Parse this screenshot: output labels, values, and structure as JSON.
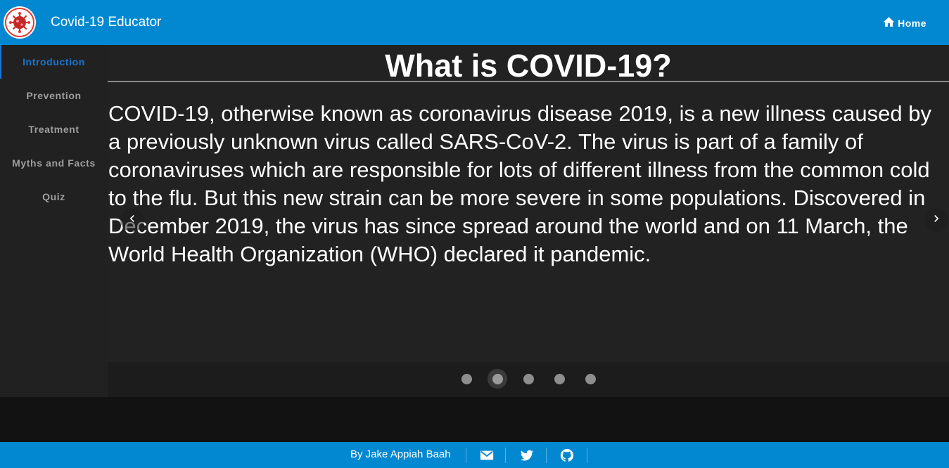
{
  "header": {
    "app_title": "Covid-19 Educator",
    "home_label": "Home",
    "logo_icon": "virus-logo-icon",
    "home_icon": "home-icon"
  },
  "sidebar": {
    "items": [
      {
        "label": "Introduction",
        "active": true
      },
      {
        "label": "Prevention",
        "active": false
      },
      {
        "label": "Treatment",
        "active": false
      },
      {
        "label": "Myths and Facts",
        "active": false
      },
      {
        "label": "Quiz",
        "active": false
      }
    ]
  },
  "slide": {
    "title": "What is COVID-19?",
    "body": "COVID-19, otherwise known as coronavirus disease 2019, is a new illness caused by a previously unknown virus called SARS-CoV-2. The virus is part of a family of coronaviruses which are responsible for lots of different illness from the common cold to the flu. But this new strain can be more severe in some populations. Discovered in December 2019, the virus has since spread around the world and on 11 March, the World Health Organization (WHO) declared it pandemic.",
    "prev_icon": "chevron-left-icon",
    "next_icon": "chevron-right-icon"
  },
  "carousel": {
    "total_slides": 5,
    "active_index": 1
  },
  "footer": {
    "credit": "By Jake Appiah Baah",
    "icons": [
      "mail-icon",
      "twitter-icon",
      "github-icon"
    ]
  },
  "colors": {
    "brand": "#0288d1",
    "active_nav": "#1976d2",
    "sidebar_bg": "#212121",
    "content_bg": "#222222"
  }
}
